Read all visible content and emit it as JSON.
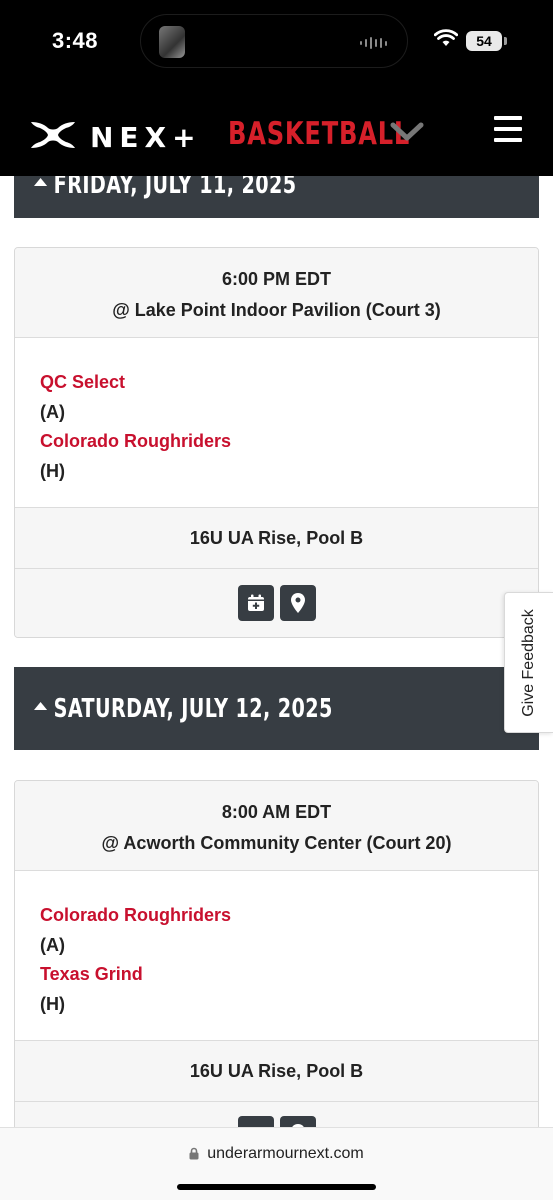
{
  "status_bar": {
    "time": "3:48",
    "battery": "54"
  },
  "header": {
    "brand_next": "NEX+",
    "brand_sport": "BASKETBALL"
  },
  "days": [
    {
      "label": "FRIDAY, JULY 11, 2025"
    },
    {
      "label": "SATURDAY, JULY 12, 2025"
    }
  ],
  "games": [
    {
      "time": "6:00 PM EDT",
      "venue": "@ Lake Point Indoor Pavilion  (Court 3)",
      "away_team": "QC Select",
      "away_tag": "(A)",
      "home_team": "Colorado Roughriders",
      "home_tag": "(H)",
      "division": "16U UA Rise, Pool B"
    },
    {
      "time": "8:00 AM EDT",
      "venue": "@ Acworth Community Center  (Court 20)",
      "away_team": "Colorado Roughriders",
      "away_tag": "(A)",
      "home_team": "Texas Grind",
      "home_tag": "(H)",
      "division": "16U UA Rise, Pool B"
    }
  ],
  "feedback": {
    "label": "Give Feedback"
  },
  "browser": {
    "url": "underarmournext.com"
  },
  "colors": {
    "team_link": "#c8102e",
    "day_header_bg": "#373d43",
    "brand_red": "#d6202a"
  }
}
